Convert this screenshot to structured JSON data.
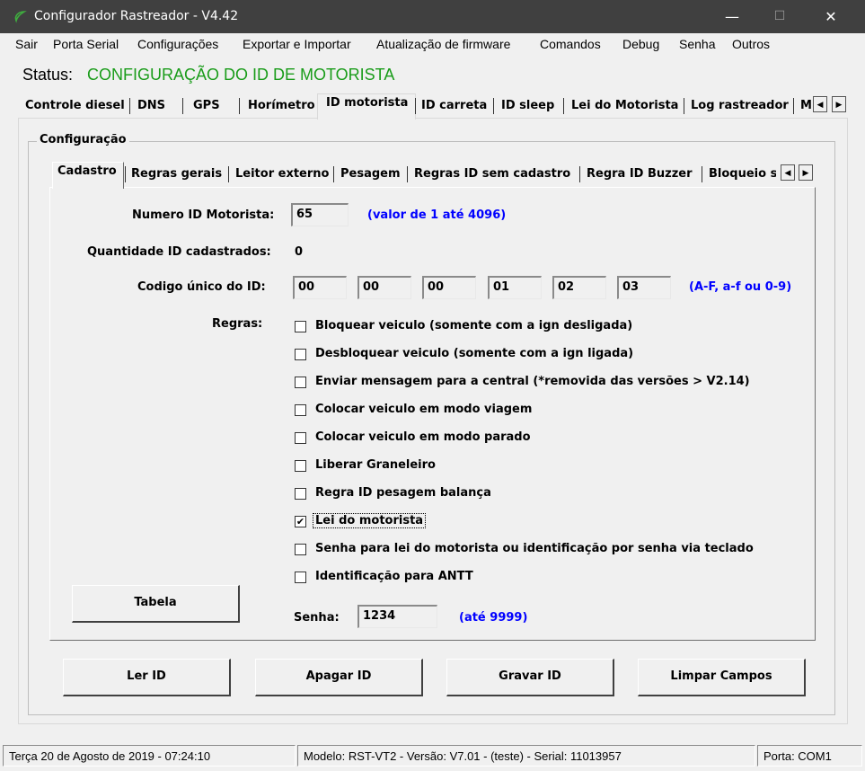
{
  "window": {
    "title": "Configurador Rastreador - V4.42",
    "minimize_glyph": "—",
    "maximize_glyph": "☐",
    "close_glyph": "✕"
  },
  "menu": [
    "Sair",
    "Porta Serial",
    "Configurações",
    "Exportar e Importar",
    "Atualização de firmware",
    "Comandos",
    "Debug",
    "Senha",
    "Outros"
  ],
  "status": {
    "label": "Status:",
    "value": "CONFIGURAÇÃO DO ID DE MOTORISTA",
    "value_color": "#1a9c1a"
  },
  "main_tabs": [
    "Controle diesel",
    "DNS",
    "GPS",
    "Horímetro",
    "ID motorista",
    "ID carreta",
    "ID sleep",
    "Lei do Motorista",
    "Log rastreador",
    "M"
  ],
  "main_tabs_selected": "ID motorista",
  "group_title": "Configuração",
  "sub_tabs": [
    "Cadastro",
    "Regras gerais",
    "Leitor externo",
    "Pesagem",
    "Regras ID sem cadastro",
    "Regra ID Buzzer",
    "Bloqueio s"
  ],
  "sub_tabs_selected": "Cadastro",
  "form": {
    "numero_label": "Numero ID Motorista:",
    "numero_value": "65",
    "numero_hint": "(valor de 1 até 4096)",
    "quantidade_label": "Quantidade ID cadastrados:",
    "quantidade_value": "0",
    "codigo_label": "Codigo único do ID:",
    "codigo_values": [
      "00",
      "00",
      "00",
      "01",
      "02",
      "03"
    ],
    "codigo_hint": "(A-F, a-f ou 0-9)",
    "regras_label": "Regras:",
    "senha_label": "Senha:",
    "senha_value": "1234",
    "senha_hint": "(até 9999)"
  },
  "rules": [
    {
      "label": "Bloquear veiculo (somente com a ign desligada)",
      "checked": false
    },
    {
      "label": "Desbloquear veiculo (somente com a ign ligada)",
      "checked": false
    },
    {
      "label": "Enviar mensagem para a central (*removida das versões > V2.14)",
      "checked": false
    },
    {
      "label": "Colocar veiculo em modo viagem",
      "checked": false
    },
    {
      "label": "Colocar veiculo em modo parado",
      "checked": false
    },
    {
      "label": "Liberar Graneleiro",
      "checked": false
    },
    {
      "label": "Regra ID pesagem balança",
      "checked": false
    },
    {
      "label": "Lei do motorista",
      "checked": true
    },
    {
      "label": "Senha para lei do motorista ou identificação por senha via teclado",
      "checked": false
    },
    {
      "label": "Identificação para ANTT",
      "checked": false
    }
  ],
  "buttons": {
    "tabela": "Tabela",
    "ler": "Ler ID",
    "apagar": "Apagar ID",
    "gravar": "Gravar ID",
    "limpar": "Limpar Campos"
  },
  "statusbar": {
    "date": "Terça 20 de Agosto de 2019  -  07:24:10",
    "model": "Modelo: RST-VT2  -  Versão: V7.01 - (teste)  -  Serial: 11013957",
    "port": "Porta: COM1"
  },
  "icons": {
    "app": "app-leaf-icon",
    "scroll_left": "scroll-left-icon",
    "scroll_right": "scroll-right-icon",
    "check": "checkmark-icon"
  }
}
